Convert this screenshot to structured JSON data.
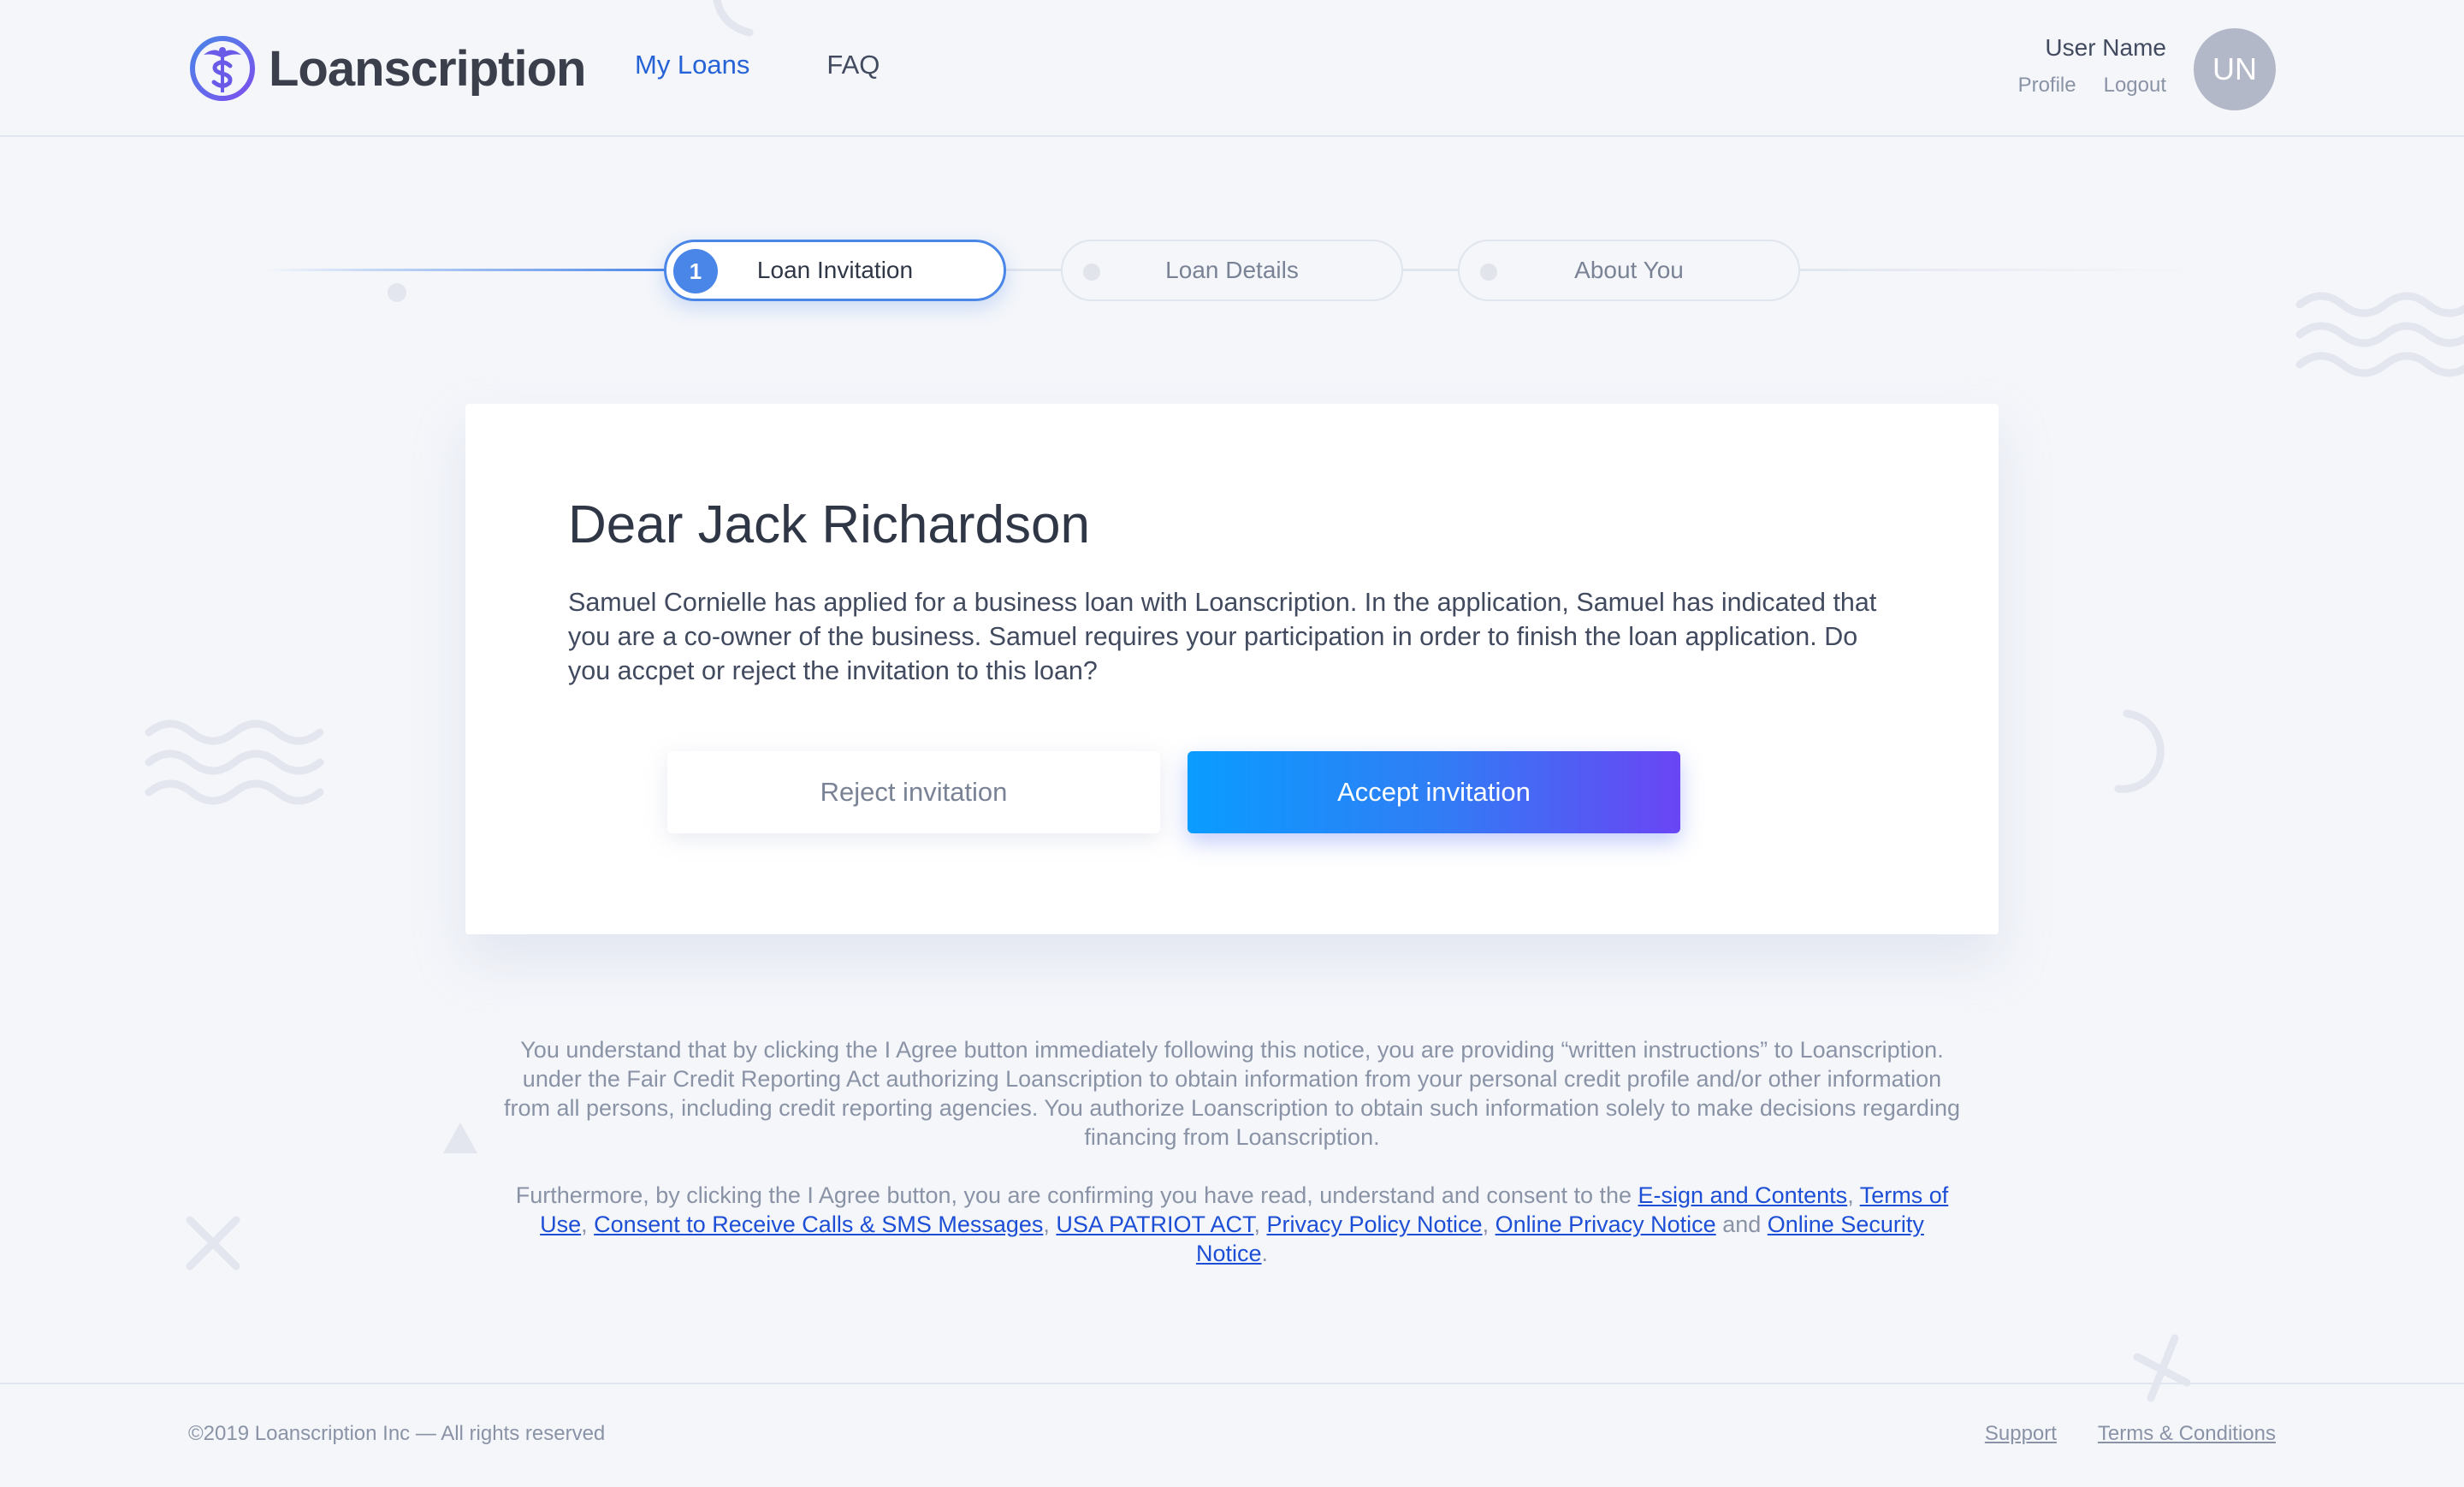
{
  "header": {
    "logo_text": "Loanscription",
    "nav": [
      {
        "label": "My Loans",
        "active": true
      },
      {
        "label": "FAQ",
        "active": false
      }
    ],
    "user": {
      "name": "User Name",
      "profile_label": "Profile",
      "logout_label": "Logout",
      "avatar_initials": "UN"
    }
  },
  "stepper": {
    "steps": [
      {
        "number": "1",
        "label": "Loan Invitation",
        "state": "active"
      },
      {
        "label": "Loan Details",
        "state": "inactive"
      },
      {
        "label": "About You",
        "state": "inactive"
      }
    ]
  },
  "invitation": {
    "title": "Dear Jack Richardson",
    "message": "Samuel Cornielle has applied for a business loan with Loanscription. In the application, Samuel has indicated that you are a co-owner of the business. Samuel requires your participation in order to finish the loan application. Do you accpet or reject the invitation to this loan?",
    "reject_label": "Reject invitation",
    "accept_label": "Accept invitation"
  },
  "legal": {
    "paragraph1": "You understand that by clicking the I Agree button immediately following this notice, you are providing “written instructions” to Loanscription. under the Fair Credit Reporting Act authorizing Loanscription to obtain information from your personal credit profile and/or other information from all persons, including credit reporting agencies. You authorize Loanscription to obtain such information solely to make decisions regarding financing from Loanscription.",
    "paragraph2_intro": "Furthermore, by clicking the I Agree button, you are confirming you have read, understand and consent to the ",
    "links": {
      "esign": "E-sign and Contents",
      "terms": "Terms of Use",
      "consent": "Consent to Receive Calls & SMS Messages",
      "patriot": "USA PATRIOT ACT",
      "privacy_policy": "Privacy Policy Notice",
      "online_privacy": "Online Privacy Notice",
      "online_security": "Online Security Notice"
    },
    "sep_comma": ", ",
    "sep_and": " and ",
    "end": "."
  },
  "footer": {
    "copyright": "©2019 Loanscription Inc — All rights reserved",
    "support_label": "Support",
    "terms_label": "Terms & Conditions"
  },
  "colors": {
    "accent": "#2563d6",
    "step_active": "#4a86e8",
    "accept_gradient_start": "#0a9cff",
    "accept_gradient_end": "#6a45f4",
    "background": "#f4f6fa"
  }
}
